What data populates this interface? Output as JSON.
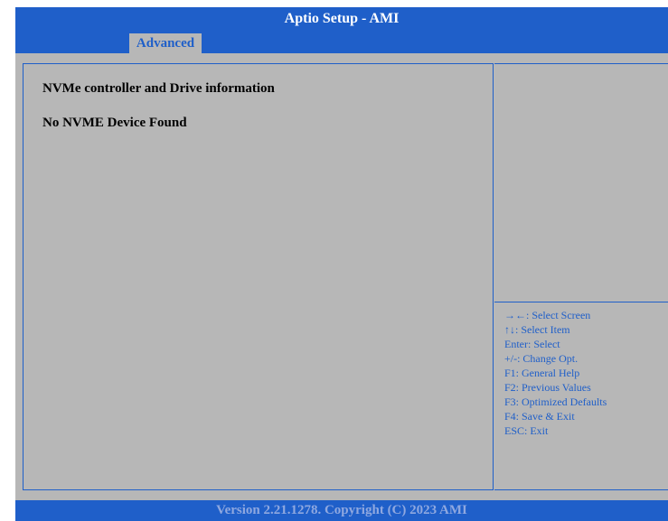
{
  "header": {
    "title": "Aptio Setup  - AMI"
  },
  "tabs": [
    {
      "label": "Advanced",
      "active": true
    }
  ],
  "main": {
    "heading": "NVMe controller and Drive information",
    "status": "No NVME Device Found"
  },
  "help": {
    "keys": [
      "→←: Select Screen",
      "↑↓: Select Item",
      "Enter: Select",
      "+/-: Change Opt.",
      "F1: General Help",
      "F2: Previous Values",
      "F3: Optimized Defaults",
      "F4: Save & Exit",
      "ESC: Exit"
    ]
  },
  "footer": {
    "text": "Version 2.21.1278. Copyright (C) 2023 AMI"
  },
  "colors": {
    "bar_blue": "#1f5fc9",
    "panel_gray": "#b7b7b7",
    "help_text": "#1f5fc9",
    "footer_text": "#8fa8e0"
  }
}
